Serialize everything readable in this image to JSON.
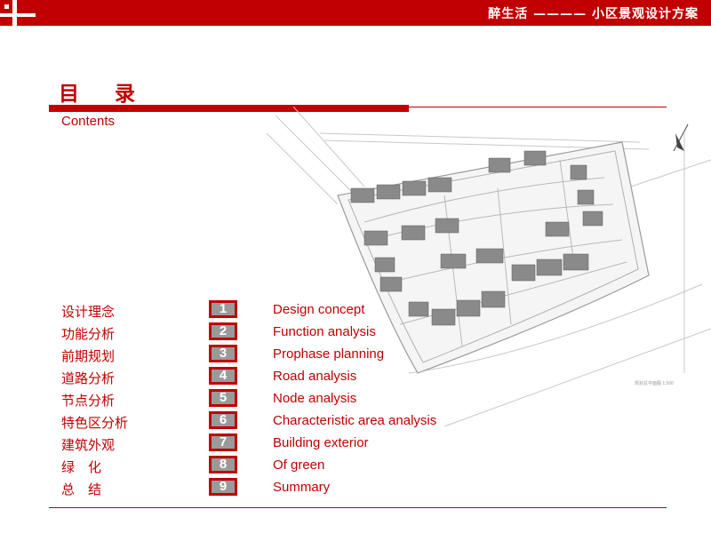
{
  "header": {
    "title": "醉生活 ———— 小区景观设计方案"
  },
  "page": {
    "title": "目录",
    "subtitle": "Contents"
  },
  "site_plan": {
    "caption": "规划总平面图 1:500"
  },
  "toc": [
    {
      "cn": "设计理念",
      "num": "1",
      "en": "Design concept"
    },
    {
      "cn": "功能分析",
      "num": "2",
      "en": "Function analysis"
    },
    {
      "cn": "前期规划",
      "num": "3",
      "en": "Prophase planning"
    },
    {
      "cn": "道路分析",
      "num": "4",
      "en": "Road analysis"
    },
    {
      "cn": "节点分析",
      "num": "5",
      "en": "Node analysis"
    },
    {
      "cn": "特色区分析",
      "num": "6",
      "en": "Characteristic area analysis"
    },
    {
      "cn": "建筑外观",
      "num": "7",
      "en": "Building exterior"
    },
    {
      "cn": "绿　化",
      "num": "8",
      "en": "Of green"
    },
    {
      "cn": "总　结",
      "num": "9",
      "en": "Summary"
    }
  ],
  "colors": {
    "accent": "#c00000",
    "number_box": "#9a9a9a",
    "background": "#ffffff"
  }
}
